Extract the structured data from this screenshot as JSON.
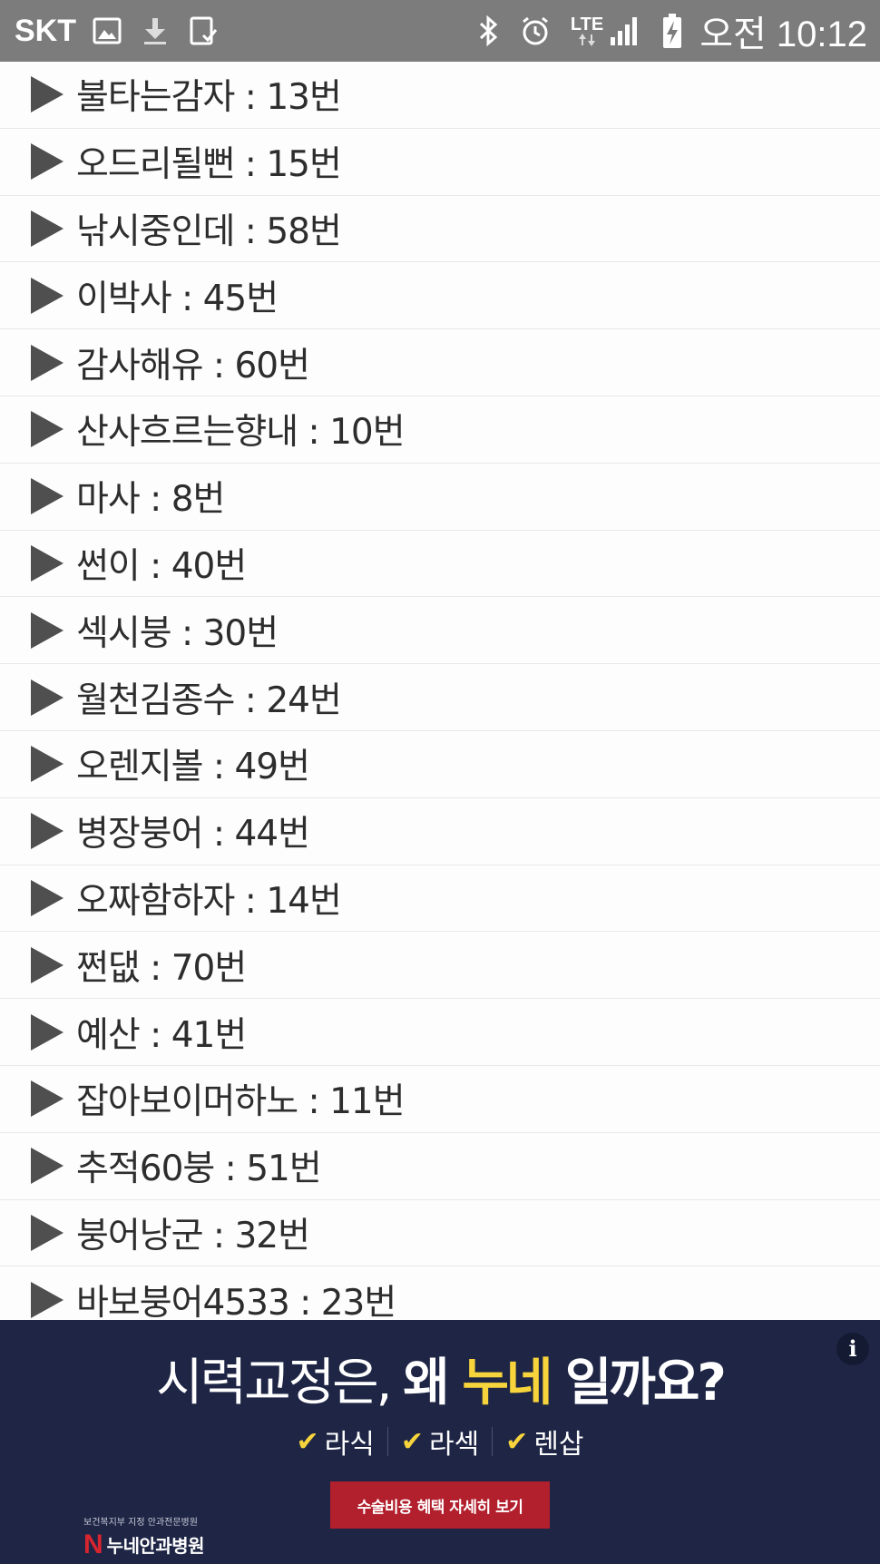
{
  "status_bar": {
    "carrier": "SKT",
    "time": "오전 10:12",
    "network": "LTE",
    "icons_left": [
      "image-icon",
      "download-icon",
      "device-icon"
    ],
    "icons_right": [
      "bluetooth-icon",
      "alarm-icon",
      "lte-icon",
      "signal-icon",
      "battery-icon"
    ]
  },
  "list": {
    "items": [
      {
        "text": "불타는감자 : 13번"
      },
      {
        "text": "오드리될뻔 : 15번"
      },
      {
        "text": "낚시중인데 : 58번"
      },
      {
        "text": "이박사 : 45번"
      },
      {
        "text": "감사해유 : 60번"
      },
      {
        "text": "산사흐르는향내 : 10번"
      },
      {
        "text": "마사 : 8번"
      },
      {
        "text": "썬이 : 40번"
      },
      {
        "text": "섹시붕 : 30번"
      },
      {
        "text": "월천김종수 : 24번"
      },
      {
        "text": "오렌지볼 : 49번"
      },
      {
        "text": "병장붕어 : 44번"
      },
      {
        "text": "오짜함하자 : 14번"
      },
      {
        "text": "쩐댒 : 70번"
      },
      {
        "text": "예산 : 41번"
      },
      {
        "text": "잡아보이머하노 : 11번"
      },
      {
        "text": "추적60붕 : 51번"
      },
      {
        "text": "붕어낭군 : 32번"
      },
      {
        "text": "바보붕어4533 : 23번"
      }
    ]
  },
  "ad": {
    "info": "i",
    "headline_part1": "시력교정은, ",
    "headline_part2": "왜 ",
    "headline_highlight": "누네",
    "headline_part3": " 일까요?",
    "checks": [
      "라식",
      "라섹",
      "렌삽"
    ],
    "check_mark": "✔",
    "cta": "수술비용 혜택 자세히 보기",
    "logo_subtitle": "보건복지부 지정 안과전문병원",
    "logo_n": "N",
    "logo_name": "누네안과병원",
    "colors": {
      "background": "#1e2545",
      "highlight": "#f7d43c",
      "cta": "#b21f2d"
    }
  }
}
